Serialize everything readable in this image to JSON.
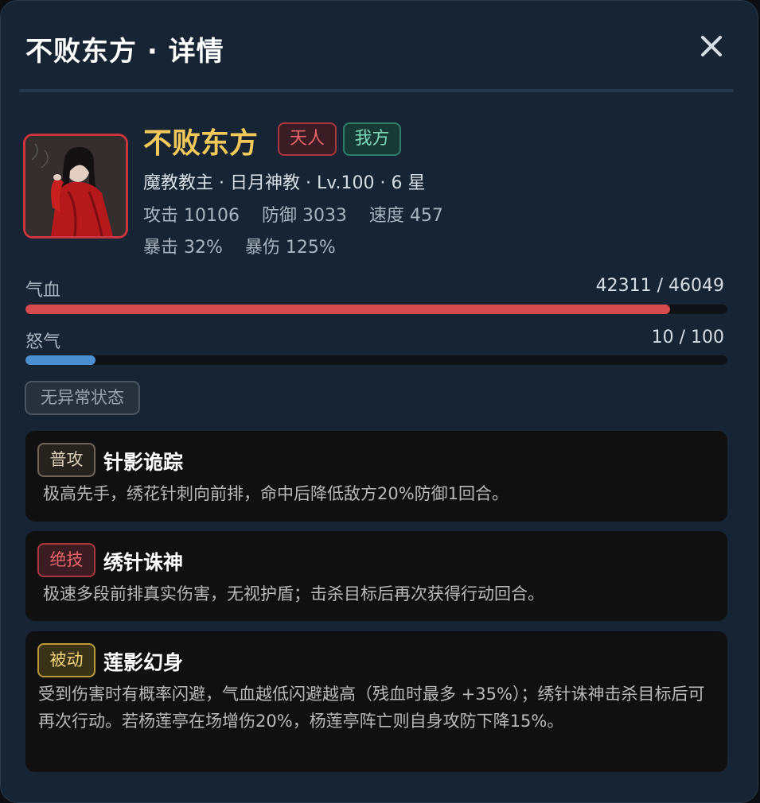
{
  "header": {
    "title": "不败东方 · 详情",
    "close_icon": "close-icon"
  },
  "hero": {
    "name": "不败东方",
    "badges": [
      {
        "label": "天人",
        "color": "#e7646a"
      },
      {
        "label": "我方",
        "color": "#7cd8b6"
      }
    ],
    "info_line": "魔教教主 · 日月神教 · Lv.100 · 6 星",
    "stats_line": "攻击 10106    防御 3033    速度 457",
    "crit_line": "暴击 32%    暴伤 125%"
  },
  "bars": {
    "hp": {
      "label": "气血",
      "value_text": "42311 / 46049",
      "current": 42311,
      "max": 46049,
      "color": "#d54a4d"
    },
    "rage": {
      "label": "怒气",
      "value_text": "10 / 100",
      "current": 10,
      "max": 100,
      "color": "#4c8fd0"
    }
  },
  "status": {
    "label": "无异常状态"
  },
  "skills": [
    {
      "tag": "普攻",
      "name": "针影诡踪",
      "desc": "极高先手，绣花针刺向前排，命中后降低敌方20%防御1回合。"
    },
    {
      "tag": "绝技",
      "name": "绣针诛神",
      "desc": "极速多段前排真实伤害，无视护盾；击杀目标后再次获得行动回合。"
    },
    {
      "tag": "被动",
      "name": "莲影幻身",
      "desc": "受到伤害时有概率闪避，气血越低闪避越高（残血时最多 +35%）；绣针诛神击杀目标后可再次行动。若杨莲亭在场增伤20%，杨莲亭阵亡则自身攻防下降15%。"
    }
  ]
}
